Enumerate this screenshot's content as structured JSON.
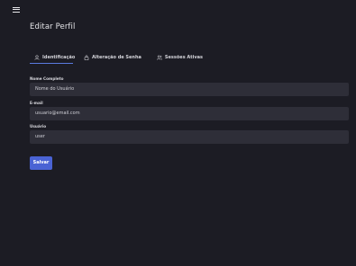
{
  "header": {
    "menu_icon": "hamburger-icon",
    "title": "Editar Perfil"
  },
  "tabs": [
    {
      "label": "Identificação",
      "icon": "user-icon",
      "active": true
    },
    {
      "label": "Alteração de Senha",
      "icon": "lock-icon",
      "active": false
    },
    {
      "label": "Sessões Ativas",
      "icon": "users-icon",
      "active": false
    }
  ],
  "form": {
    "full_name": {
      "label": "Nome Completo",
      "value": "Nome do Usuário"
    },
    "email": {
      "label": "E-mail",
      "value": "usuario@email.com"
    },
    "username": {
      "label": "Usuário",
      "value": "user"
    },
    "save_label": "Salvar"
  },
  "colors": {
    "background": "#1c1c24",
    "field_background": "#2e2e38",
    "accent": "#4a63d4"
  }
}
